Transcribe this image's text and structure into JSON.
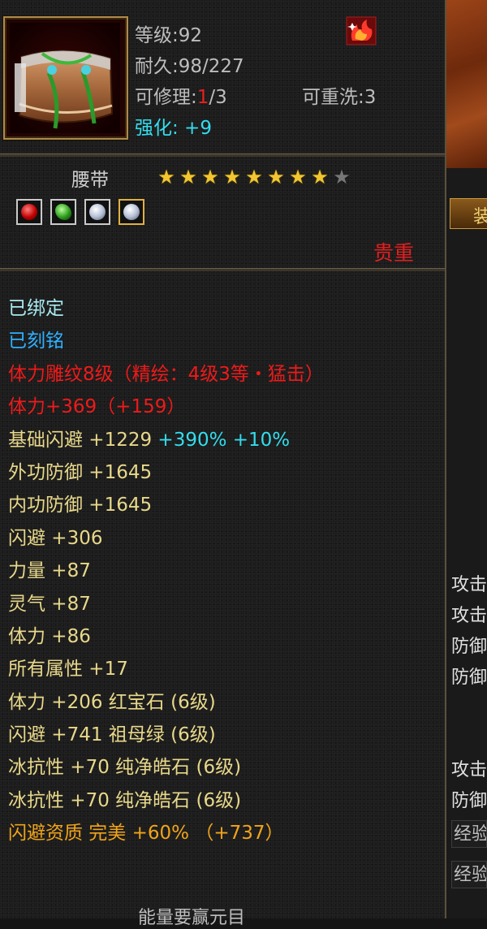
{
  "item": {
    "level": "等级:92",
    "durability": "耐久:98/227",
    "repair_label": "可修理:",
    "repair_used": "1",
    "repair_max": "/3",
    "rewash": "可重洗:3",
    "enhance": "强化: +9",
    "name": "腰带",
    "stars_filled": 8,
    "stars_total": 9,
    "rarity": "贵重"
  },
  "gems": [
    "red-gem-icon",
    "green-gem-icon",
    "white-gem-icon",
    "white-gem-icon"
  ],
  "attributes": [
    {
      "text": "已绑定",
      "color": "cyan"
    },
    {
      "text": "已刻铭",
      "color": "blue"
    },
    {
      "text": "体力雕纹8级（精绘：4级3等・猛击）",
      "color": "red"
    },
    {
      "text": "体力+369（+159）",
      "color": "red"
    },
    {
      "text": "基础闪避 +1229",
      "extra": " +390% +10%",
      "color": "yellow"
    },
    {
      "text": "外功防御 +1645",
      "color": "yellow"
    },
    {
      "text": "内功防御 +1645",
      "color": "yellow"
    },
    {
      "text": "闪避 +306",
      "color": "yellow"
    },
    {
      "text": "力量 +87",
      "color": "yellow"
    },
    {
      "text": "灵气 +87",
      "color": "yellow"
    },
    {
      "text": "体力 +86",
      "color": "yellow"
    },
    {
      "text": "所有属性 +17",
      "color": "yellow"
    },
    {
      "text": "体力 +206 红宝石 (6级)",
      "color": "yellow"
    },
    {
      "text": "闪避 +741 祖母绿 (6级)",
      "color": "yellow"
    },
    {
      "text": "冰抗性 +70 纯净皓石 (6级)",
      "color": "yellow"
    },
    {
      "text": "冰抗性 +70 纯净皓石 (6级)",
      "color": "yellow"
    },
    {
      "text": "闪避资质  完美  +60% （+737）",
      "color": "orange"
    }
  ],
  "bottom": "能量要赢元目",
  "right_panel": {
    "bar1": "装",
    "texts": [
      "攻击",
      "攻击",
      "防御",
      "防御",
      "攻击",
      "防御"
    ],
    "cells": [
      "经验",
      "经验"
    ]
  }
}
